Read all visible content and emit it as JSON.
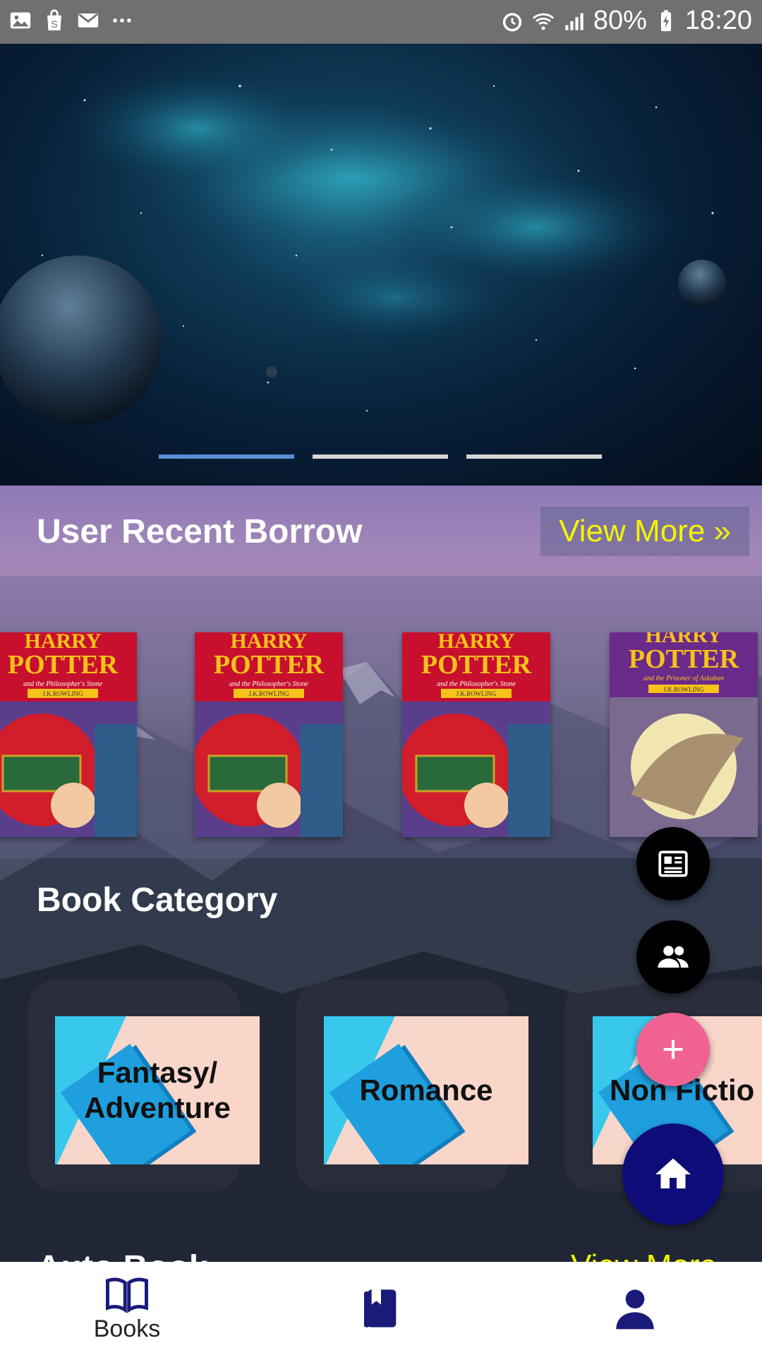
{
  "status_bar": {
    "icons_left": [
      "gallery-icon",
      "shopping-bag-icon",
      "mail-icon",
      "more-dots-icon"
    ],
    "icons_right": [
      "alarm-icon",
      "wifi-icon",
      "signal-icon",
      "battery-charging-icon"
    ],
    "battery": "80%",
    "time": "18:20"
  },
  "banner": {
    "slides": 3,
    "active_slide": 0
  },
  "recent_borrow": {
    "title": "User Recent Borrow",
    "view_more": "View More »",
    "books": [
      {
        "title_line1": "HARRY",
        "title_line2": "POTTER",
        "subtitle": "and the Philosopher's Stone",
        "author": "J.K.ROWLING",
        "color": "#c8102e"
      },
      {
        "title_line1": "HARRY",
        "title_line2": "POTTER",
        "subtitle": "and the Philosopher's Stone",
        "author": "J.K.ROWLING",
        "color": "#c8102e"
      },
      {
        "title_line1": "HARRY",
        "title_line2": "POTTER",
        "subtitle": "and the Philosopher's Stone",
        "author": "J.K.ROWLING",
        "color": "#c8102e"
      },
      {
        "title_line1": "HARRY",
        "title_line2": "POTTER",
        "subtitle": "and the Prisoner of Azkaban",
        "author": "J.K.ROWLING",
        "color": "#6a2a8a"
      }
    ]
  },
  "book_category": {
    "title": "Book Category",
    "categories": [
      "Fantasy/\nAdventure",
      "Romance",
      "Non Fictio"
    ]
  },
  "auto_section": {
    "title": "Auto Book",
    "view_more": "View More"
  },
  "fabs": [
    "newspaper-icon",
    "group-icon",
    "add-icon",
    "home-icon"
  ],
  "bottom_nav": {
    "items": [
      {
        "label": "Books",
        "icon": "open-book-icon"
      },
      {
        "label": "",
        "icon": "bookmark-book-icon"
      },
      {
        "label": "",
        "icon": "person-icon"
      }
    ],
    "accent": "#1a1a7a"
  }
}
